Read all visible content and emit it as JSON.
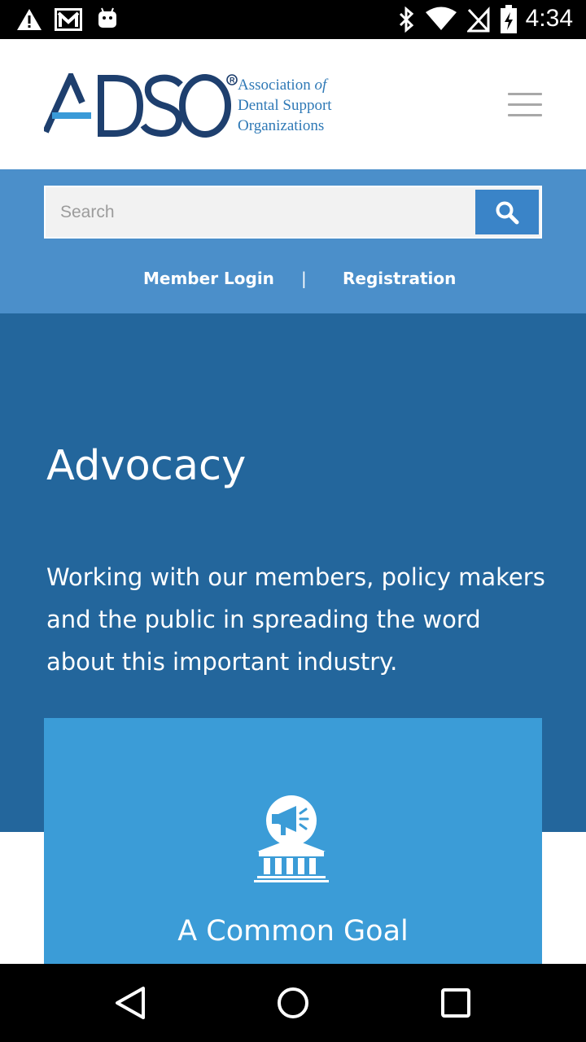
{
  "status_bar": {
    "time": "4:34",
    "icons_left": [
      "warning-icon",
      "gmail-icon",
      "android-icon"
    ],
    "icons_right": [
      "bluetooth-icon",
      "wifi-icon",
      "no-signal-icon",
      "battery-charging-icon"
    ]
  },
  "header": {
    "logo_wordmark": "ADSO",
    "logo_line1_a": "Association ",
    "logo_line1_b": "of",
    "logo_line2": "Dental Support",
    "logo_line3": "Organizations",
    "menu_icon": "hamburger-menu-icon"
  },
  "search": {
    "placeholder": "Search",
    "value": "",
    "button_icon": "search-icon"
  },
  "links": {
    "member_login": "Member Login",
    "separator": "|",
    "registration": "Registration"
  },
  "hero": {
    "title": "Advocacy",
    "description": "Working with our members, policy makers and the public in spreading the word about this important industry."
  },
  "card": {
    "icon": "megaphone-building-icon",
    "title": "A Common Goal"
  },
  "nav_bar": {
    "back_icon": "back-triangle-icon",
    "home_icon": "home-circle-icon",
    "recents_icon": "recents-square-icon"
  },
  "colors": {
    "header_bg": "#ffffff",
    "search_band_bg": "#4b8fca",
    "hero_bg": "#23669c",
    "card_bg": "#3b9cd7",
    "logo_navy": "#1e3f6e",
    "logo_blue": "#2f79b6"
  }
}
